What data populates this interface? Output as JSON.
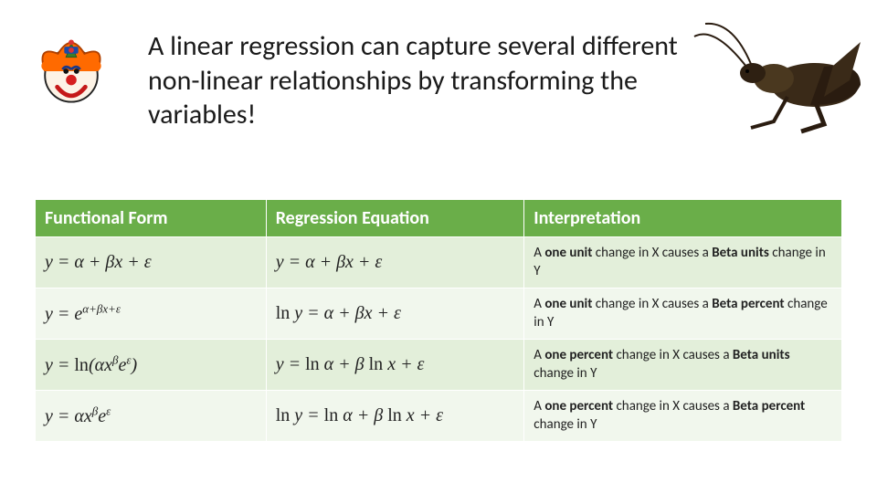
{
  "title": "A linear regression can capture several different non-linear relationships by transforming the variables!",
  "icons": {
    "clown": "clown-icon",
    "cricket": "cricket-icon"
  },
  "table": {
    "headers": {
      "ff": "Functional Form",
      "eq": "Regression Equation",
      "int": "Interpretation"
    },
    "rows": [
      {
        "ff_html": "<span class='eq'>y = α + βx + ε</span>",
        "eq_html": "<span class='eq'>y = α + βx + ε</span>",
        "int_html": "A <b>one unit</b> change in X causes a <b>Beta units</b> change in Y"
      },
      {
        "ff_html": "<span class='eq'>y = e<sup>α+βx+ε</sup></span>",
        "eq_html": "<span class='eq'><span class='fn'>ln</span> y = α + βx + ε</span>",
        "int_html": "A <b>one unit</b> change in X causes a <b>Beta percent</b> change in Y"
      },
      {
        "ff_html": "<span class='eq'>y = <span class='fn'>ln</span>(αx<sup>β</sup>e<sup>ε</sup>)</span>",
        "eq_html": "<span class='eq'>y = <span class='fn'>ln</span> α + β <span class='fn'>ln</span> x + ε</span>",
        "int_html": "A <b>one percent</b> change in X causes a <b>Beta units</b> change in Y"
      },
      {
        "ff_html": "<span class='eq'>y = αx<sup>β</sup>e<sup>ε</sup></span>",
        "eq_html": "<span class='eq'><span class='fn'>ln</span> y = <span class='fn'>ln</span> α + β <span class='fn'>ln</span> x + ε</span>",
        "int_html": "A <b>one percent</b> change in X causes a <b>Beta percent</b> change in Y"
      }
    ]
  }
}
